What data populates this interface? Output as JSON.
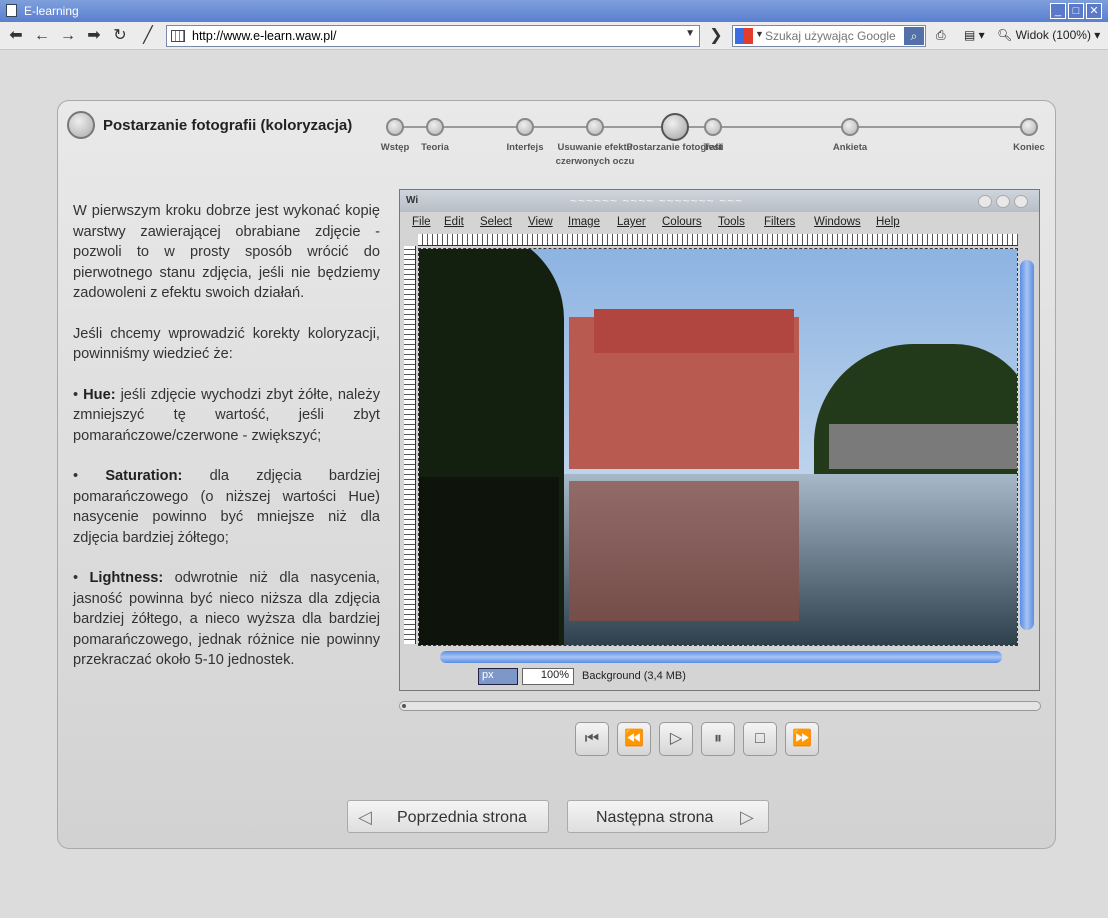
{
  "window": {
    "title": "E-learning"
  },
  "toolbar": {
    "url": "http://www.e-learn.waw.pl/",
    "search_placeholder": "Szukaj używając Google",
    "view_label": "Widok (100%)"
  },
  "lesson": {
    "title": "Postarzanie fotografii (koloryzacja)",
    "steps": [
      {
        "label": "Wstęp"
      },
      {
        "label": "Teoria"
      },
      {
        "label": "Interfejs"
      },
      {
        "label": "Usuwanie efektu czerwonych oczu"
      },
      {
        "label": "Postarzanie fotografii",
        "current": true
      },
      {
        "label": "Test"
      },
      {
        "label": "Ankieta"
      },
      {
        "label": "Koniec"
      }
    ],
    "paragraphs": [
      {
        "bold": "",
        "text": "W pierwszym kroku dobrze jest wykonać kopię warstwy zawierającej obrabiane zdjęcie - pozwoli to w prosty sposób wrócić do pierwotnego stanu zdjęcia, jeśli nie będziemy zadowoleni z efektu swoich działań."
      },
      {
        "bold": "",
        "text": "Jeśli chcemy wprowadzić korekty koloryzacji, powinniśmy wiedzieć że:"
      },
      {
        "bold": "Hue:",
        "text": " jeśli zdjęcie wychodzi zbyt żółte, należy zmniejszyć tę wartość, jeśli zbyt pomarańczowe/czerwone - zwiększyć;"
      },
      {
        "bold": "Saturation:",
        "text": " dla zdjęcia bardziej pomarańczowego (o niższej wartości Hue) nasycenie powinno być mniejsze niż dla zdjęcia bardziej żółtego;"
      },
      {
        "bold": "Lightness:",
        "text": " odwrotnie niż dla nasycenia, jasność powinna być nieco niższa dla zdjęcia bardziej żółtego, a nieco wyższa dla bardziej pomarańczowego, jednak różnice nie powinny przekraczać około 5-10 jednostek."
      }
    ]
  },
  "gimp": {
    "menu": [
      "File",
      "Edit",
      "Select",
      "View",
      "Image",
      "Layer",
      "Colours",
      "Tools",
      "Filters",
      "Windows",
      "Help"
    ],
    "unit": "px",
    "zoom": "100%",
    "layer_info": "Background (3,4 MB)"
  },
  "player": {
    "progress": 0.0
  },
  "nav": {
    "prev_label": "Poprzednia strona",
    "next_label": "Następna strona"
  }
}
